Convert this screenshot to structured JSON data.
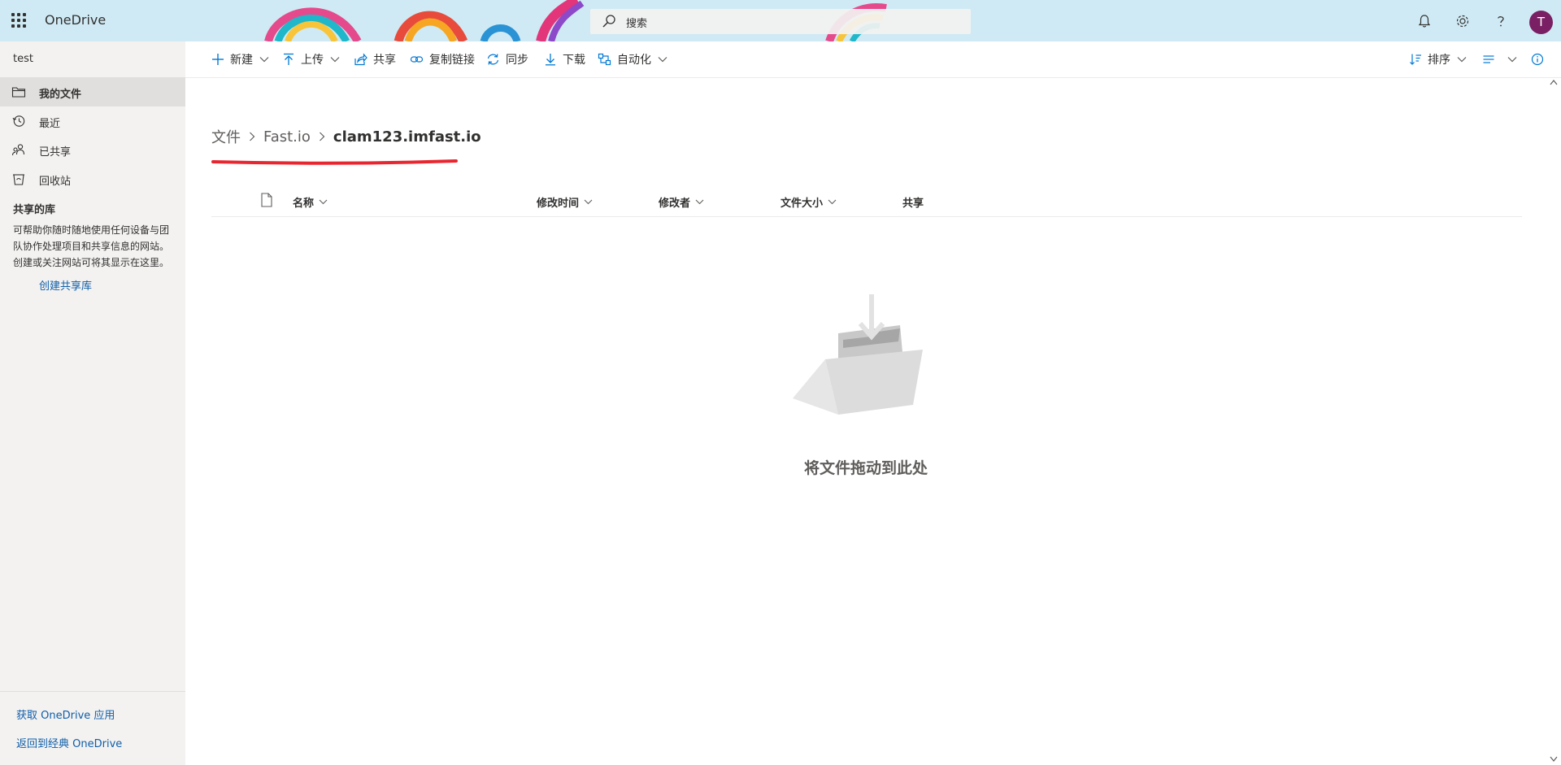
{
  "header": {
    "app_name": "OneDrive",
    "search_placeholder": "搜索",
    "avatar_initial": "T",
    "icons": [
      "waffle-icon",
      "search-icon",
      "bell-icon",
      "gear-icon",
      "help-icon"
    ]
  },
  "sidebar": {
    "user_name": "test",
    "items": [
      {
        "label": "我的文件",
        "icon": "folder-icon",
        "active": true
      },
      {
        "label": "最近",
        "icon": "history-icon",
        "active": false
      },
      {
        "label": "已共享",
        "icon": "people-icon",
        "active": false
      },
      {
        "label": "回收站",
        "icon": "recycle-bin-icon",
        "active": false
      }
    ],
    "shared_libraries": {
      "heading": "共享的库",
      "description": "可帮助你随时随地使用任何设备与团队协作处理项目和共享信息的网站。创建或关注网站可将其显示在这里。",
      "create_link": "创建共享库"
    },
    "footer_links": [
      "获取 OneDrive 应用",
      "返回到经典 OneDrive"
    ]
  },
  "commandbar": {
    "new": "新建",
    "upload": "上传",
    "share": "共享",
    "copy_link": "复制链接",
    "sync": "同步",
    "download": "下载",
    "automate": "自动化",
    "sort": "排序"
  },
  "breadcrumb": [
    "文件",
    "Fast.io",
    "clam123.imfast.io"
  ],
  "list": {
    "columns": [
      "名称",
      "修改时间",
      "修改者",
      "文件大小",
      "共享"
    ]
  },
  "empty_state": {
    "message": "将文件拖动到此处"
  },
  "colors": {
    "header_bg": "#cfeaf4",
    "sidebar_bg": "#f3f2f1",
    "accent_blue": "#0078d4",
    "link_blue": "#0f5ea8",
    "avatar_bg": "#7a1f63",
    "annotation_red": "#e8262f"
  }
}
